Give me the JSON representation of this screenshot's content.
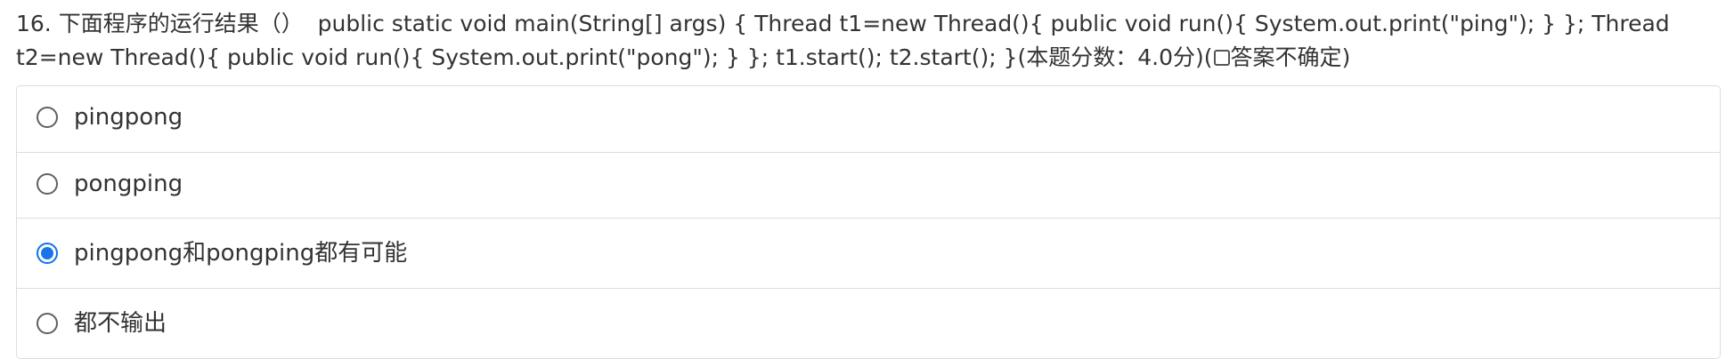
{
  "question": {
    "number": "16.",
    "title": "下面程序的运行结果（）",
    "code": "public static void main(String[] args) { Thread t1=new Thread(){ public void run(){ System.out.print(\"ping\"); } }; Thread t2=new Thread(){ public void run(){ System.out.print(\"pong\"); } }; t1.start(); t2.start(); }",
    "score": "(本题分数：4.0分)",
    "unsure_prefix": "(",
    "unsure_label": "答案不确定",
    "unsure_suffix": ")",
    "unsure_checked": false
  },
  "options": [
    {
      "label": "pingpong",
      "selected": false
    },
    {
      "label": "pongping",
      "selected": false
    },
    {
      "label": "pingpong和pongping都有可能",
      "selected": true
    },
    {
      "label": "都不输出",
      "selected": false
    }
  ],
  "colors": {
    "accent": "#1a74e8",
    "text": "#333333",
    "border": "#dddddd"
  }
}
